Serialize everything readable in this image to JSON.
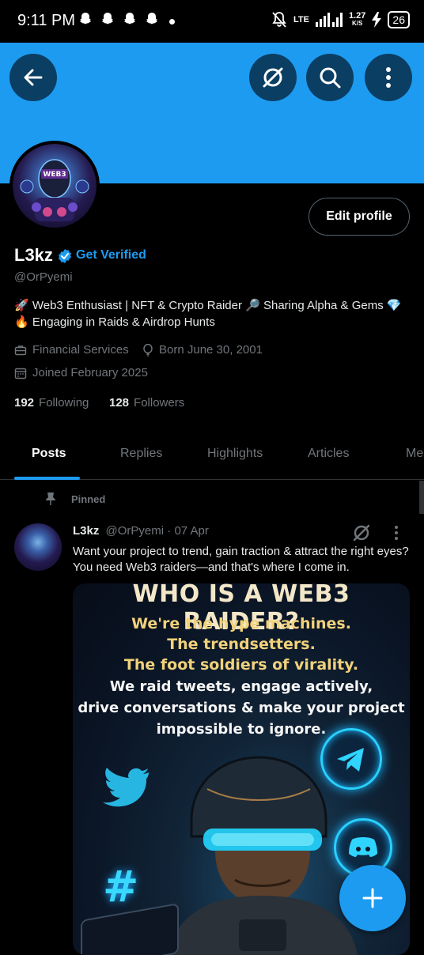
{
  "status_bar": {
    "time": "9:11 PM",
    "network_label": "LTE",
    "speed": "1.27",
    "speed_unit": "K/S",
    "battery": "26"
  },
  "profile": {
    "display_name": "L3kz",
    "get_verified_label": "Get Verified",
    "handle": "@OrPyemi",
    "bio_line1": "🚀 Web3 Enthusiast | NFT & Crypto Raider 🔎 Sharing Alpha & Gems 💎",
    "bio_line2": "🔥 Engaging in Raids & Airdrop Hunts",
    "category": "Financial Services",
    "born": "Born June 30, 2001",
    "joined": "Joined February 2025",
    "following_count": "192",
    "following_label": "Following",
    "followers_count": "128",
    "followers_label": "Followers",
    "edit_profile_label": "Edit profile",
    "avatar_text": "WEB3"
  },
  "tabs": [
    {
      "label": "Posts",
      "active": true
    },
    {
      "label": "Replies",
      "active": false
    },
    {
      "label": "Highlights",
      "active": false
    },
    {
      "label": "Articles",
      "active": false
    },
    {
      "label": "Me",
      "active": false
    }
  ],
  "post": {
    "pinned_label": "Pinned",
    "author": "L3kz",
    "handle": "@OrPyemi",
    "date": "· 07 Apr",
    "text": "Want your project to trend, gain traction & attract the right eyes? You need Web3 raiders—and that's where I come in.",
    "image": {
      "title": "WHO IS A WEB3 RAIDER?",
      "yellow_lines": [
        "We're the hype machines.",
        "The trendsetters.",
        "The foot soldiers of virality."
      ],
      "white_lines": [
        "We raid tweets, engage actively,",
        "drive conversations & make your project",
        "impossible to ignore."
      ]
    }
  },
  "colors": {
    "accent": "#1d9bf0",
    "banner": "#1d9bf0",
    "header_button_bg": "#0b3e63",
    "muted_text": "#71767b",
    "background": "#000000"
  },
  "icons": {
    "back": "arrow-left-icon",
    "grok": "grok-icon",
    "search": "search-icon",
    "more": "more-vertical-icon",
    "verified": "verified-badge-icon",
    "category": "briefcase-icon",
    "born": "balloon-icon",
    "joined": "calendar-icon",
    "pin": "pin-icon",
    "compose": "plus-icon"
  }
}
